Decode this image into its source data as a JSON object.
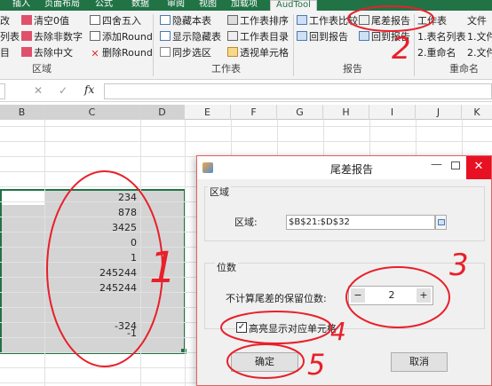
{
  "ribbon_tabs": [
    "插入",
    "页面布局",
    "公式",
    "数据",
    "审阅",
    "视图",
    "加载项",
    "AudTool"
  ],
  "ribbon": {
    "group1": {
      "items": [
        "改",
        "列表",
        "目"
      ],
      "items2": [
        "清空0值",
        "去除非数字",
        "去除中文"
      ],
      "items3": [
        "四舍五入",
        "添加Round",
        "删除Round"
      ],
      "label": "区域"
    },
    "group2": {
      "items": [
        "隐藏本表",
        "显示隐藏表",
        "同步选区"
      ],
      "items2": [
        "工作表排序",
        "工作表目录",
        "透视单元格"
      ],
      "label": "工作表"
    },
    "group3": {
      "items": [
        "工作表比较",
        "回到报告"
      ],
      "items2": [
        "尾差报告",
        "回到报告"
      ],
      "label": "报告"
    },
    "group4": {
      "items": [
        "工作表",
        "1.表名列表",
        "2.重命名"
      ],
      "items2": [
        "文件",
        "1.文件",
        "2.文件"
      ],
      "label": "重命名"
    }
  },
  "formula_bar": {
    "fx": "fx",
    "cancel": "✕",
    "confirm": "✓"
  },
  "columns": [
    "B",
    "C",
    "D",
    "E",
    "F",
    "G",
    "H",
    "I",
    "J",
    "K"
  ],
  "cells": [
    {
      "row": 1,
      "value": "234"
    },
    {
      "row": 2,
      "value": "878"
    },
    {
      "row": 3,
      "value": "3425"
    },
    {
      "row": 4,
      "value": "0"
    },
    {
      "row": 5,
      "value": "1"
    },
    {
      "row": 6,
      "value": "245244"
    },
    {
      "row": 7,
      "value": "245244"
    },
    {
      "row": 8,
      "value": ""
    },
    {
      "row": 9,
      "value": ""
    },
    {
      "row": 10,
      "value": "-324"
    },
    {
      "row": 11,
      "value": "-1"
    }
  ],
  "dialog": {
    "title": "尾差报告",
    "region_group": "区域",
    "region_label": "区域:",
    "region_value": "$B$21:$D$32",
    "digits_group": "位数",
    "digits_label": "不计算尾差的保留位数:",
    "digits_value": "2",
    "minus": "−",
    "plus": "+",
    "highlight_label": "高亮显示对应单元格",
    "highlight_checked": true,
    "ok": "确定",
    "cancel": "取消"
  },
  "annotations": [
    "1",
    "2",
    "3",
    "4",
    "5"
  ]
}
